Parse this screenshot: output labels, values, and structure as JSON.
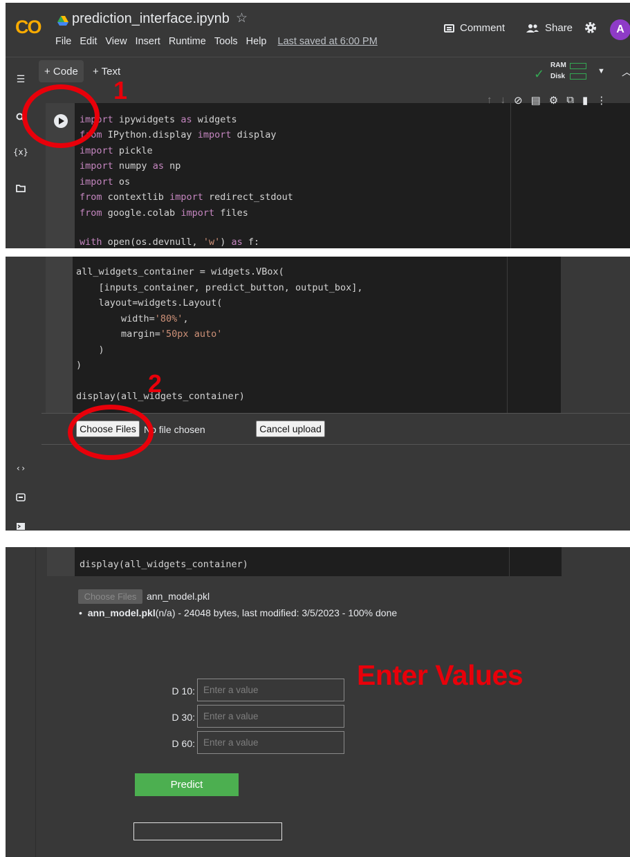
{
  "header": {
    "logo": "CO",
    "file_title": "prediction_interface.ipynb",
    "star": "☆",
    "menu": [
      "File",
      "Edit",
      "View",
      "Insert",
      "Runtime",
      "Tools",
      "Help"
    ],
    "last_saved": "Last saved at 6:00 PM",
    "comment_label": "Comment",
    "share_label": "Share",
    "avatar_letter": "A"
  },
  "toolbar": {
    "add_code": "+ Code",
    "add_text": "+ Text",
    "ram_label": "RAM",
    "disk_label": "Disk"
  },
  "annotations": {
    "step1": "1",
    "step2": "2",
    "enter_values": "Enter Values"
  },
  "cell1": {
    "lines": [
      "import ipywidgets as widgets",
      "from IPython.display import display",
      "import pickle",
      "import numpy as np",
      "import os",
      "from contextlib import redirect_stdout",
      "from google.colab import files",
      "",
      "with open(os.devnull, 'w') as f:"
    ]
  },
  "cell2": {
    "lines": [
      "all_widgets_container = widgets.VBox(",
      "    [inputs_container, predict_button, output_box],",
      "    layout=widgets.Layout(",
      "        width='80%',",
      "        margin='50px auto'",
      "    )",
      ")",
      "",
      "display(all_widgets_container)"
    ]
  },
  "upload": {
    "choose_files": "Choose Files",
    "no_file": "No file chosen",
    "cancel_upload": "Cancel upload"
  },
  "cell3": {
    "code": "display(all_widgets_container)",
    "choose_files": "Choose Files",
    "file_name": "ann_model.pkl",
    "bullet": "•",
    "file_bold": "ann_model.pkl",
    "file_details": "(n/a) - 24048 bytes, last modified: 3/5/2023 - 100% done"
  },
  "form": {
    "fields": [
      {
        "label": "D 10:",
        "placeholder": "Enter a value"
      },
      {
        "label": "D 30:",
        "placeholder": "Enter a value"
      },
      {
        "label": "D 60:",
        "placeholder": "Enter a value"
      }
    ],
    "predict_label": "Predict",
    "predict_color": "#4caf50"
  },
  "colors": {
    "annotation_red": "#e8000a",
    "background": "#383838",
    "code_background": "#1e1e1e"
  }
}
